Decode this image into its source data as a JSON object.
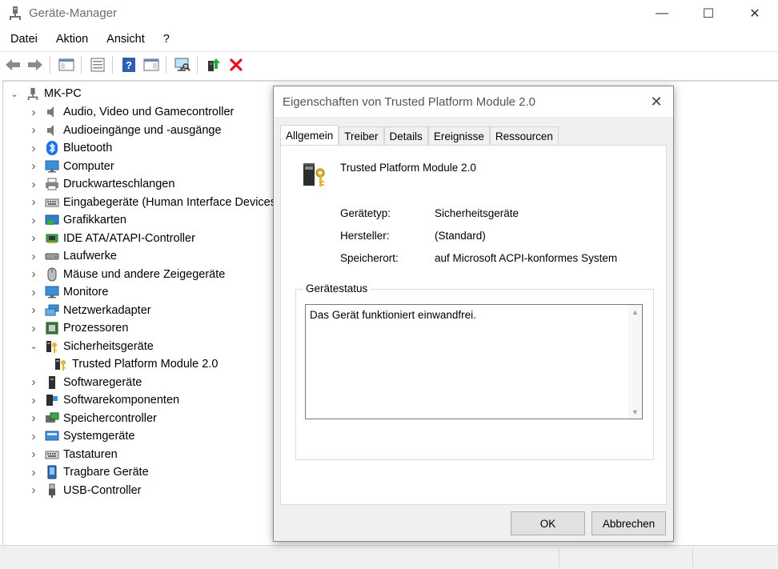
{
  "window": {
    "title": "Geräte-Manager",
    "minimize": "—",
    "maximize": "☐",
    "close": "✕"
  },
  "menu": [
    "Datei",
    "Aktion",
    "Ansicht",
    "?"
  ],
  "tree": {
    "root": "MK-PC",
    "items": [
      {
        "label": "Audio, Video und Gamecontroller",
        "icon": "speaker-icon",
        "expanded": false
      },
      {
        "label": "Audioeingänge und -ausgänge",
        "icon": "speaker-icon",
        "expanded": false
      },
      {
        "label": "Bluetooth",
        "icon": "bluetooth-icon",
        "expanded": false
      },
      {
        "label": "Computer",
        "icon": "monitor-icon",
        "expanded": false
      },
      {
        "label": "Druckwarteschlangen",
        "icon": "printer-icon",
        "expanded": false
      },
      {
        "label": "Eingabegeräte (Human Interface Devices)",
        "icon": "keyboard-icon",
        "expanded": false
      },
      {
        "label": "Grafikkarten",
        "icon": "display-adapter-icon",
        "expanded": false
      },
      {
        "label": "IDE ATA/ATAPI-Controller",
        "icon": "ide-controller-icon",
        "expanded": false
      },
      {
        "label": "Laufwerke",
        "icon": "drive-icon",
        "expanded": false
      },
      {
        "label": "Mäuse und andere Zeigegeräte",
        "icon": "mouse-icon",
        "expanded": false
      },
      {
        "label": "Monitore",
        "icon": "monitor-icon",
        "expanded": false
      },
      {
        "label": "Netzwerkadapter",
        "icon": "network-icon",
        "expanded": false
      },
      {
        "label": "Prozessoren",
        "icon": "processor-icon",
        "expanded": false
      },
      {
        "label": "Sicherheitsgeräte",
        "icon": "security-key-icon",
        "expanded": true
      },
      {
        "label": "Trusted Platform Module 2.0",
        "icon": "security-key-icon",
        "child": true
      },
      {
        "label": "Softwaregeräte",
        "icon": "software-device-icon",
        "expanded": false
      },
      {
        "label": "Softwarekomponenten",
        "icon": "software-component-icon",
        "expanded": false
      },
      {
        "label": "Speichercontroller",
        "icon": "storage-controller-icon",
        "expanded": false
      },
      {
        "label": "Systemgeräte",
        "icon": "system-device-icon",
        "expanded": false
      },
      {
        "label": "Tastaturen",
        "icon": "keyboard-icon",
        "expanded": false
      },
      {
        "label": "Tragbare Geräte",
        "icon": "portable-device-icon",
        "expanded": false
      },
      {
        "label": "USB-Controller",
        "icon": "usb-icon",
        "expanded": false
      }
    ]
  },
  "dialog": {
    "title": "Eigenschaften von Trusted Platform Module 2.0",
    "tabs": [
      "Allgemein",
      "Treiber",
      "Details",
      "Ereignisse",
      "Ressourcen"
    ],
    "active_tab": "Allgemein",
    "device_name": "Trusted Platform Module 2.0",
    "properties": [
      {
        "label": "Gerätetyp:",
        "value": "Sicherheitsgeräte"
      },
      {
        "label": "Hersteller:",
        "value": "(Standard)"
      },
      {
        "label": "Speicherort:",
        "value": "auf Microsoft ACPI-konformes System"
      }
    ],
    "status_legend": "Gerätestatus",
    "status_text": "Das Gerät funktioniert einwandfrei.",
    "ok": "OK",
    "cancel": "Abbrechen"
  },
  "colors": {
    "accent": "#0078d7",
    "error_red": "#e81123"
  }
}
